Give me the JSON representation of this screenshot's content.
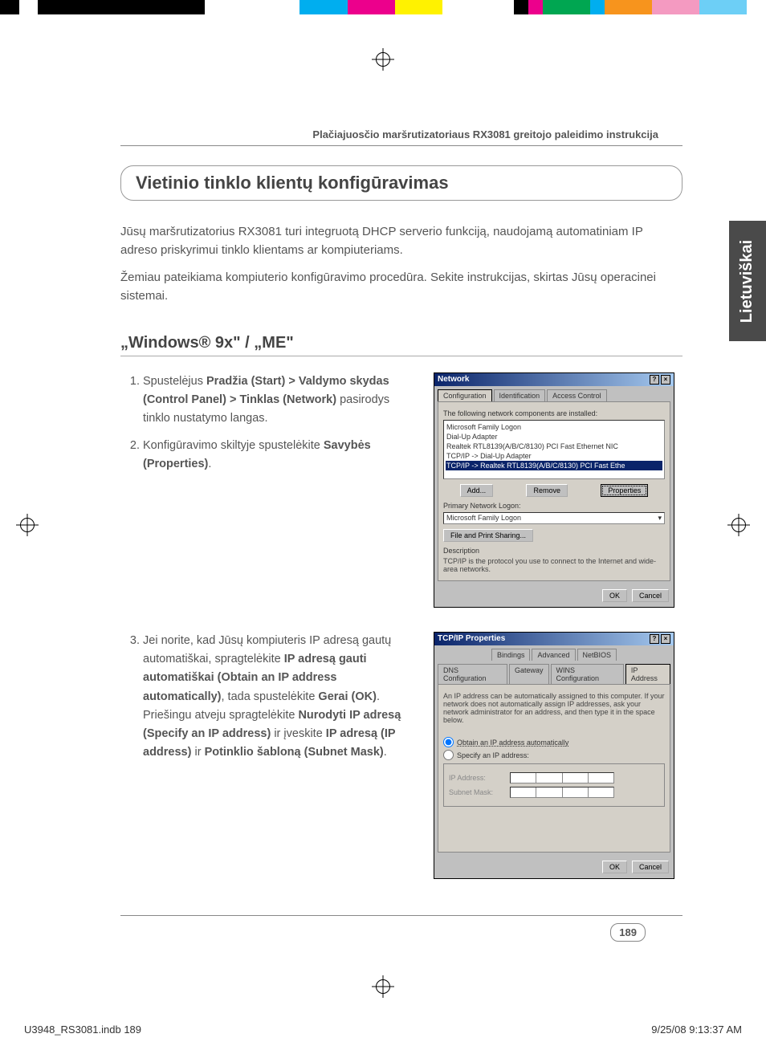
{
  "colorbar": [
    "#000",
    "#fff",
    "#000",
    "#000",
    "#fff",
    "#fff",
    "#00aeef",
    "#ec008c",
    "#fff200",
    "#fff",
    "#fff",
    "#000",
    "#ec008c",
    "#00a651",
    "#00aeef",
    "#f7941d",
    "#ec008c",
    "#00aeef",
    "#fff"
  ],
  "header": "Plačiajuosčio maršrutizatoriaus RX3081 greitojo paleidimo instrukcija",
  "side_tab": "Lietuviškai",
  "section_title": "Vietinio tinklo klientų konfigūravimas",
  "intro1": "Jūsų maršrutizatorius RX3081 turi integruotą DHCP serverio funkciją, naudojamą automatiniam IP adreso priskyrimui tinklo klientams ar kompiuteriams.",
  "intro2": "Žemiau pateikiama kompiuterio konfigūravimo procedūra. Sekite instrukcijas, skirtas Jūsų operacinei sistemai.",
  "sub_header": "„Windows® 9x\" / „ME\"",
  "step1_pre": "Spustelėjus ",
  "step1_bold": "Pradžia (Start) > Valdymo skydas (Control Panel) > Tinklas (Network)",
  "step1_post": " pasirodys tinklo nustatymo langas.",
  "step2_pre": "Konfigūravimo skiltyje spustelėkite ",
  "step2_bold": "Savybės (Properties)",
  "step2_post": ".",
  "step3_pre": "Jei norite, kad Jūsų kompiuteris IP adresą gautų automatiškai, spragtelėkite ",
  "step3_b1": "IP adresą gauti automatiškai (Obtain an IP address automatically)",
  "step3_mid1": ", tada spustelėkite ",
  "step3_b2": "Gerai (OK)",
  "step3_mid2": ". Priešingu atveju spragtelėkite ",
  "step3_b3": "Nurodyti IP adresą (Specify an IP address)",
  "step3_mid3": " ir įveskite ",
  "step3_b4": "IP adresą (IP address)",
  "step3_mid4": " ir ",
  "step3_b5": "Potinklio šabloną (Subnet Mask)",
  "step3_post": ".",
  "dlg1": {
    "title": "Network",
    "tabs": [
      "Configuration",
      "Identification",
      "Access Control"
    ],
    "label_top": "The following network components are installed:",
    "items": [
      "Microsoft Family Logon",
      "Dial-Up Adapter",
      "Realtek RTL8139(A/B/C/8130) PCI Fast Ethernet NIC",
      "TCP/IP -> Dial-Up Adapter",
      "TCP/IP -> Realtek RTL8139(A/B/C/8130) PCI Fast Ethe"
    ],
    "btn_add": "Add...",
    "btn_remove": "Remove",
    "btn_props": "Properties",
    "label_logon": "Primary Network Logon:",
    "logon_value": "Microsoft Family Logon",
    "btn_share": "File and Print Sharing...",
    "label_desc": "Description",
    "desc_text": "TCP/IP is the protocol you use to connect to the Internet and wide-area networks.",
    "ok": "OK",
    "cancel": "Cancel"
  },
  "dlg2": {
    "title": "TCP/IP Properties",
    "tabs_top": [
      "Bindings",
      "Advanced",
      "NetBIOS"
    ],
    "tabs_bot": [
      "DNS Configuration",
      "Gateway",
      "WINS Configuration",
      "IP Address"
    ],
    "info": "An IP address can be automatically assigned to this computer. If your network does not automatically assign IP addresses, ask your network administrator for an address, and then type it in the space below.",
    "radio1": "Obtain an IP address automatically",
    "radio2": "Specify an IP address:",
    "ip_label": "IP Address:",
    "mask_label": "Subnet Mask:",
    "ok": "OK",
    "cancel": "Cancel"
  },
  "page_number": "189",
  "footer_left": "U3948_RS3081.indb   189",
  "footer_right": "9/25/08   9:13:37 AM"
}
